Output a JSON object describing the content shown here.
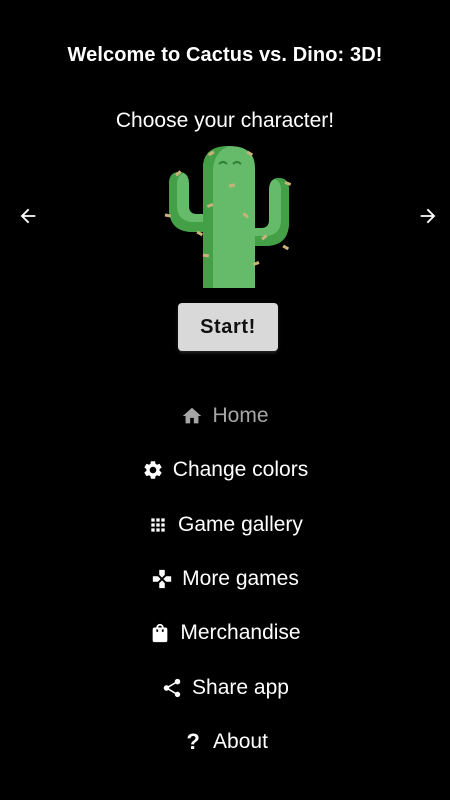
{
  "header": {
    "title": "Welcome to Cactus vs. Dino: 3D!",
    "subtitle": "Choose your character!"
  },
  "carousel": {
    "prev_icon": "arrow-left-icon",
    "next_icon": "arrow-right-icon",
    "character_icon": "cactus-icon"
  },
  "start_label": "Start!",
  "menu": {
    "items": [
      {
        "label": "Home",
        "icon": "home-icon",
        "active": true
      },
      {
        "label": "Change colors",
        "icon": "gear-icon"
      },
      {
        "label": "Game gallery",
        "icon": "grid-icon"
      },
      {
        "label": "More games",
        "icon": "gamepad-icon"
      },
      {
        "label": "Merchandise",
        "icon": "shopping-bag-icon"
      },
      {
        "label": "Share app",
        "icon": "share-icon"
      },
      {
        "label": "About",
        "icon": "question-icon"
      }
    ]
  },
  "colors": {
    "background": "#000000",
    "text": "#ffffff",
    "active_item": "#a6a6a6",
    "button": "#d9d9d9",
    "cactus_green": "#4caf50"
  }
}
